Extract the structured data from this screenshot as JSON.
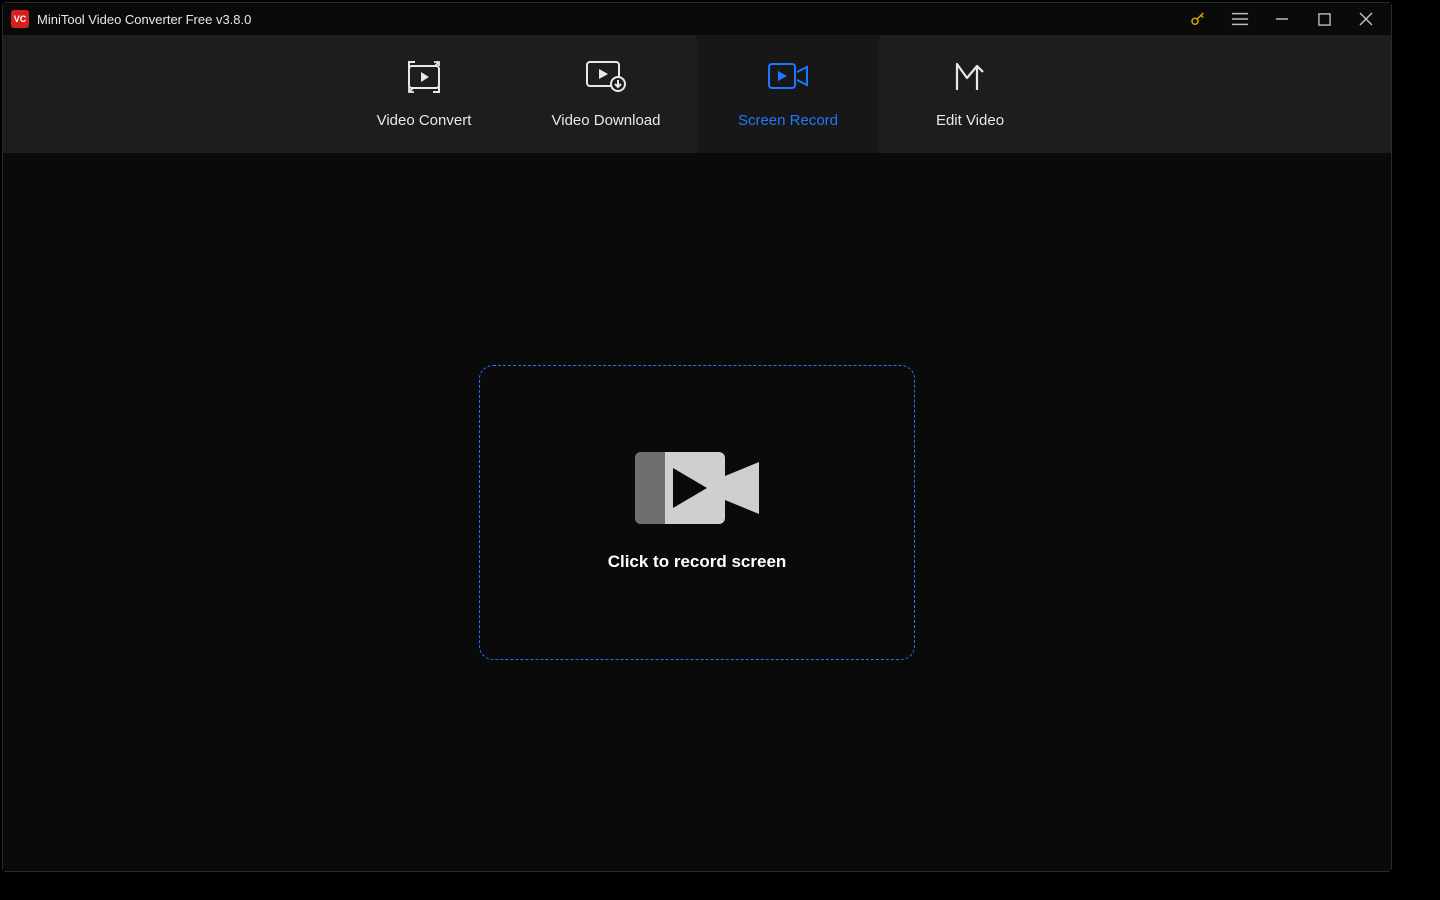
{
  "titlebar": {
    "app_title": "MiniTool Video Converter Free v3.8.0",
    "logo_text": "VC"
  },
  "tabs": {
    "convert": {
      "label": "Video Convert"
    },
    "download": {
      "label": "Video Download"
    },
    "record": {
      "label": "Screen Record"
    },
    "edit": {
      "label": "Edit Video"
    }
  },
  "main": {
    "record_cta": "Click to record screen"
  },
  "colors": {
    "accent": "#1e78ff",
    "brand": "#d61f1f"
  }
}
